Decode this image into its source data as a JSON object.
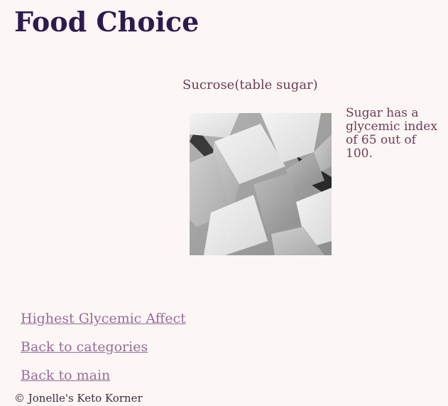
{
  "header": {
    "title": "Food Choice"
  },
  "food": {
    "name": "Sucrose(table sugar)",
    "image_subject": "sugar-cubes",
    "description": "Sugar has a glycemic index of 65 out of 100."
  },
  "nav": {
    "links": [
      {
        "label": "Highest Glycemic Affect"
      },
      {
        "label": "Back to categories"
      },
      {
        "label": "Back to main"
      }
    ]
  },
  "footer": {
    "copyright": "© Jonelle's Keto Korner"
  },
  "colors": {
    "background": "#fcf7f5",
    "title": "#2e1a4f",
    "text": "#6e3a55",
    "link": "#9a6b99",
    "footer": "#3d2a3a"
  }
}
